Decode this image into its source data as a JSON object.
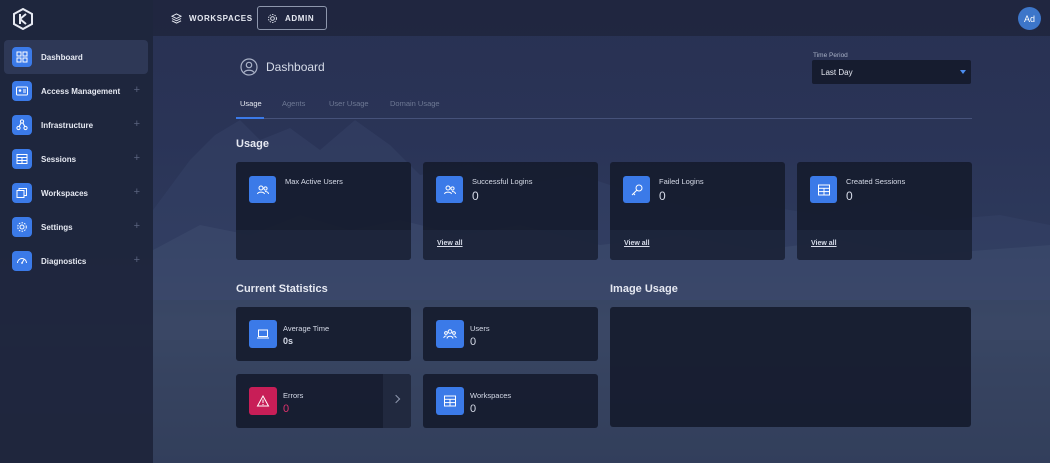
{
  "colors": {
    "accent": "#3b7ae8",
    "error": "#c81e57",
    "sidebar_bg": "#1e253c",
    "card_bg": "#161c2e"
  },
  "topbar": {
    "workspaces_label": "WORKSPACES",
    "admin_label": "ADMIN",
    "avatar_text": "Ad"
  },
  "sidebar": {
    "items": [
      {
        "label": "Dashboard",
        "icon": "grid-icon"
      },
      {
        "label": "Access Management",
        "icon": "id-card-icon"
      },
      {
        "label": "Infrastructure",
        "icon": "network-icon"
      },
      {
        "label": "Sessions",
        "icon": "table-icon"
      },
      {
        "label": "Workspaces",
        "icon": "layers-icon"
      },
      {
        "label": "Settings",
        "icon": "gear-icon"
      },
      {
        "label": "Diagnostics",
        "icon": "gauge-icon"
      }
    ],
    "expand_symbol": "+"
  },
  "page": {
    "title": "Dashboard",
    "time_period": {
      "label": "Time Period",
      "value": "Last Day"
    },
    "tabs": [
      "Usage",
      "Agents",
      "User Usage",
      "Domain Usage"
    ]
  },
  "usage": {
    "title": "Usage",
    "cards": [
      {
        "label": "Max Active Users",
        "value": "",
        "link": ""
      },
      {
        "label": "Successful Logins",
        "value": "0",
        "link": "View all"
      },
      {
        "label": "Failed Logins",
        "value": "0",
        "link": "View all"
      },
      {
        "label": "Created Sessions",
        "value": "0",
        "link": "View all"
      }
    ]
  },
  "current_statistics": {
    "title": "Current Statistics",
    "average_time": {
      "label": "Average Time",
      "value": "0s"
    },
    "users": {
      "label": "Users",
      "value": "0"
    },
    "errors": {
      "label": "Errors",
      "value": "0"
    },
    "workspaces": {
      "label": "Workspaces",
      "value": "0"
    }
  },
  "image_usage": {
    "title": "Image Usage"
  }
}
